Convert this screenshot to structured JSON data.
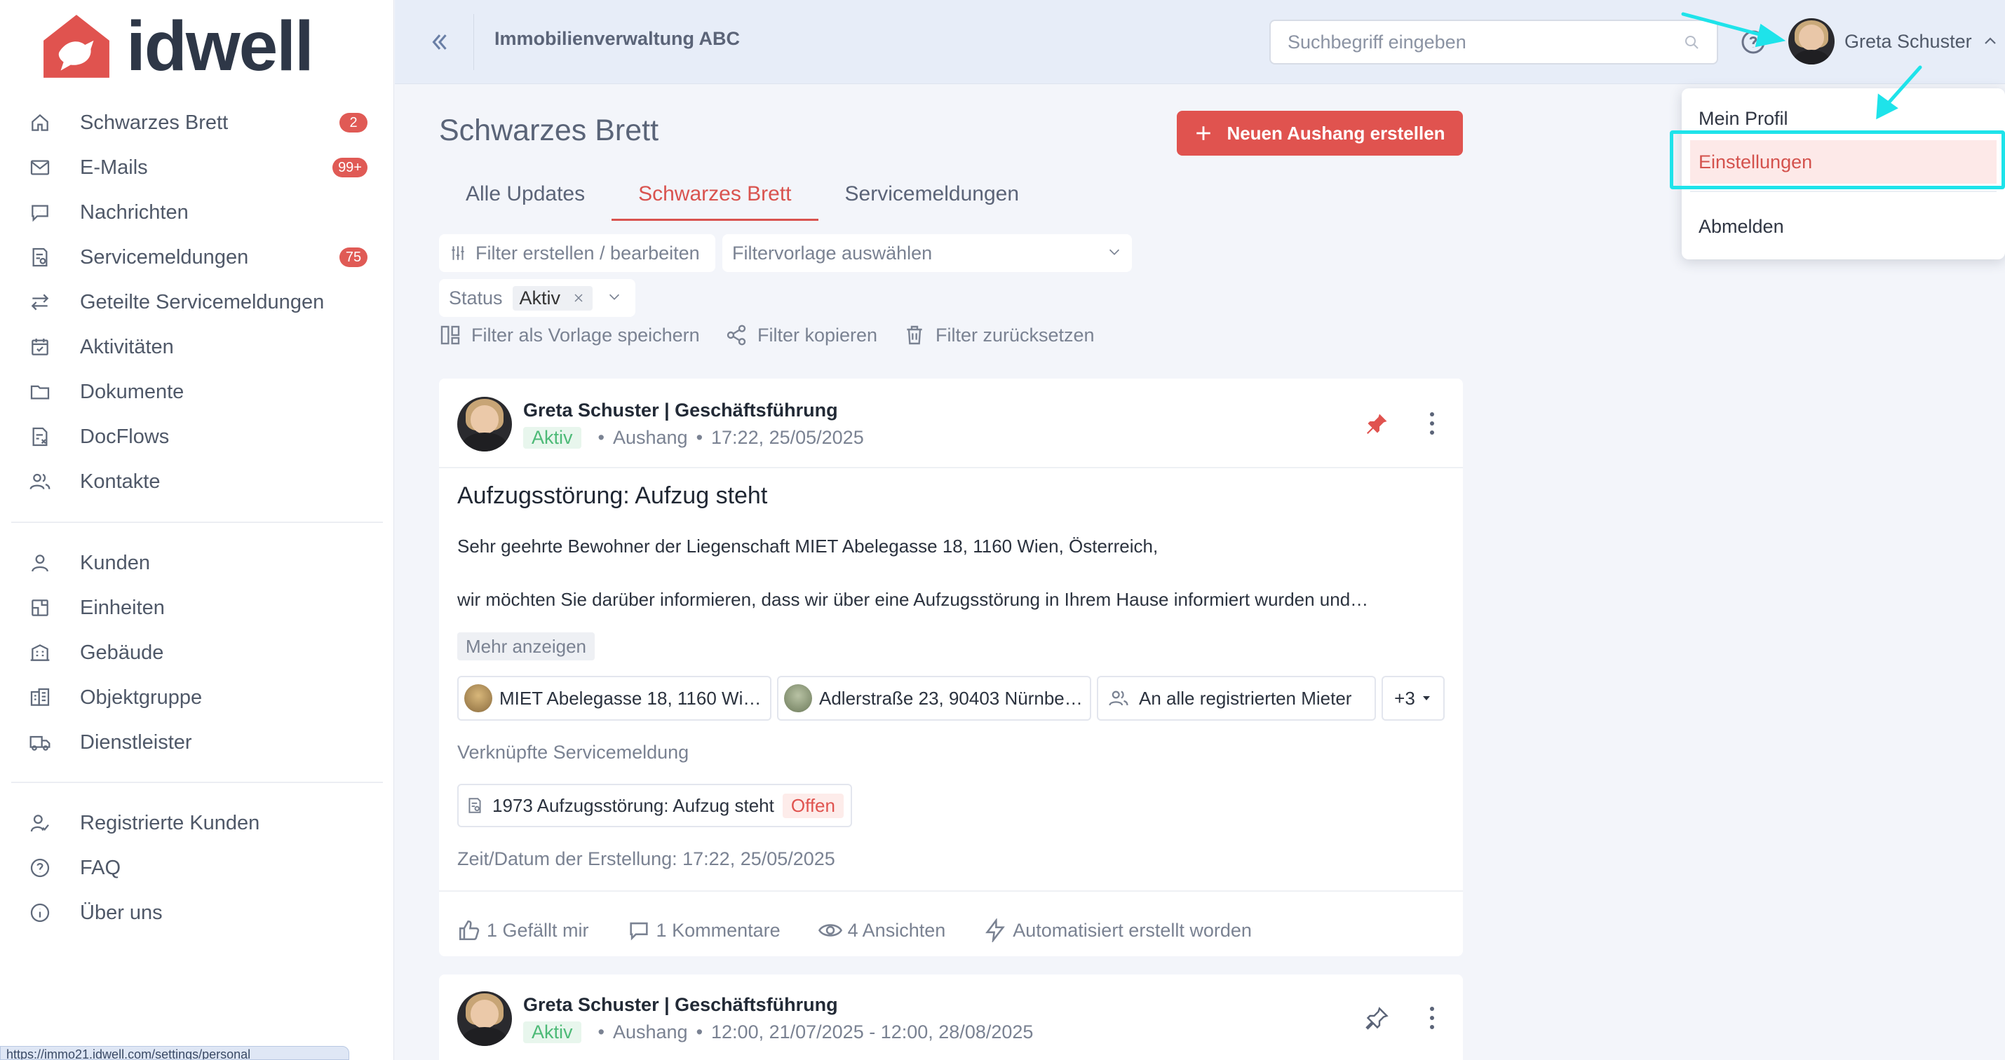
{
  "app": {
    "brand": "idwell",
    "status_url": "https://immo21.idwell.com/settings/personal"
  },
  "colors": {
    "accent": "#e0534f",
    "highlight": "#1ee3ea",
    "success": "#4dba77"
  },
  "sidebar": {
    "main": [
      {
        "label": "Schwarzes Brett",
        "badge": "2",
        "icon": "home-icon"
      },
      {
        "label": "E-Mails",
        "badge": "99+",
        "icon": "mail-icon"
      },
      {
        "label": "Nachrichten",
        "badge": "",
        "icon": "chat-icon"
      },
      {
        "label": "Servicemeldungen",
        "badge": "75",
        "icon": "service-ticket-icon"
      },
      {
        "label": "Geteilte Servicemeldungen",
        "badge": "",
        "icon": "swap-arrows-icon"
      },
      {
        "label": "Aktivitäten",
        "badge": "",
        "icon": "calendar-icon"
      },
      {
        "label": "Dokumente",
        "badge": "",
        "icon": "folder-icon"
      },
      {
        "label": "DocFlows",
        "badge": "",
        "icon": "docflow-icon"
      },
      {
        "label": "Kontakte",
        "badge": "",
        "icon": "contacts-icon"
      }
    ],
    "objects": [
      {
        "label": "Kunden",
        "icon": "user-icon"
      },
      {
        "label": "Einheiten",
        "icon": "unit-icon"
      },
      {
        "label": "Gebäude",
        "icon": "building-icon"
      },
      {
        "label": "Objektgruppe",
        "icon": "object-group-icon"
      },
      {
        "label": "Dienstleister",
        "icon": "truck-icon"
      }
    ],
    "info": [
      {
        "label": "Registrierte Kunden",
        "icon": "registered-user-icon"
      },
      {
        "label": "FAQ",
        "icon": "question-icon"
      },
      {
        "label": "Über uns",
        "icon": "info-icon"
      }
    ]
  },
  "topbar": {
    "org_title": "Immobilienverwaltung ABC",
    "search_placeholder": "Suchbegriff eingeben",
    "user_name": "Greta Schuster"
  },
  "profile_menu": {
    "items": [
      {
        "label": "Mein Profil"
      },
      {
        "label": "Einstellungen",
        "active": true
      },
      {
        "label": "Abmelden"
      }
    ]
  },
  "main": {
    "title": "Schwarzes Brett",
    "create_button": "Neuen Aushang erstellen",
    "tabs": [
      {
        "label": "Alle Updates"
      },
      {
        "label": "Schwarzes Brett",
        "active": true
      },
      {
        "label": "Servicemeldungen"
      }
    ],
    "filters": {
      "edit_filter": "Filter erstellen / bearbeiten",
      "template_select": "Filtervorlage auswählen",
      "status_label": "Status",
      "status_value": "Aktiv",
      "save_template": "Filter als Vorlage speichern",
      "copy_filter": "Filter kopieren",
      "reset_filter": "Filter zurücksetzen"
    }
  },
  "posts": [
    {
      "author": "Greta Schuster | Geschäftsführung",
      "status": "Aktiv",
      "type": "Aushang",
      "timestamp": "17:22, 25/05/2025",
      "title": "Aufzugsstörung: Aufzug steht",
      "line1": "Sehr geehrte Bewohner der Liegenschaft MIET Abelegasse 18, 1160 Wien, Österreich,",
      "line2": "wir möchten Sie darüber informieren, dass wir über eine Aufzugsstörung in Ihrem Hause informiert wurden und…",
      "more": "Mehr anzeigen",
      "recipients": [
        "MIET Abelegasse 18, 1160 Wi…",
        "Adlerstraße 23, 90403 Nürnbe…",
        "An alle registrierten Mieter"
      ],
      "recipients_more": "+3",
      "linked_label": "Verknüpfte Servicemeldung",
      "linked_ticket": "1973 Aufzugsstörung: Aufzug steht",
      "linked_status": "Offen",
      "created_at": "Zeit/Datum der Erstellung: 17:22, 25/05/2025",
      "likes": "1 Gefällt mir",
      "comments": "1 Kommentare",
      "views": "4 Ansichten",
      "auto": "Automatisiert erstellt worden",
      "pinned": true
    },
    {
      "author": "Greta Schuster | Geschäftsführung",
      "status": "Aktiv",
      "type": "Aushang",
      "timestamp": "12:00, 21/07/2025 - 12:00, 28/08/2025",
      "pinned": false
    }
  ]
}
